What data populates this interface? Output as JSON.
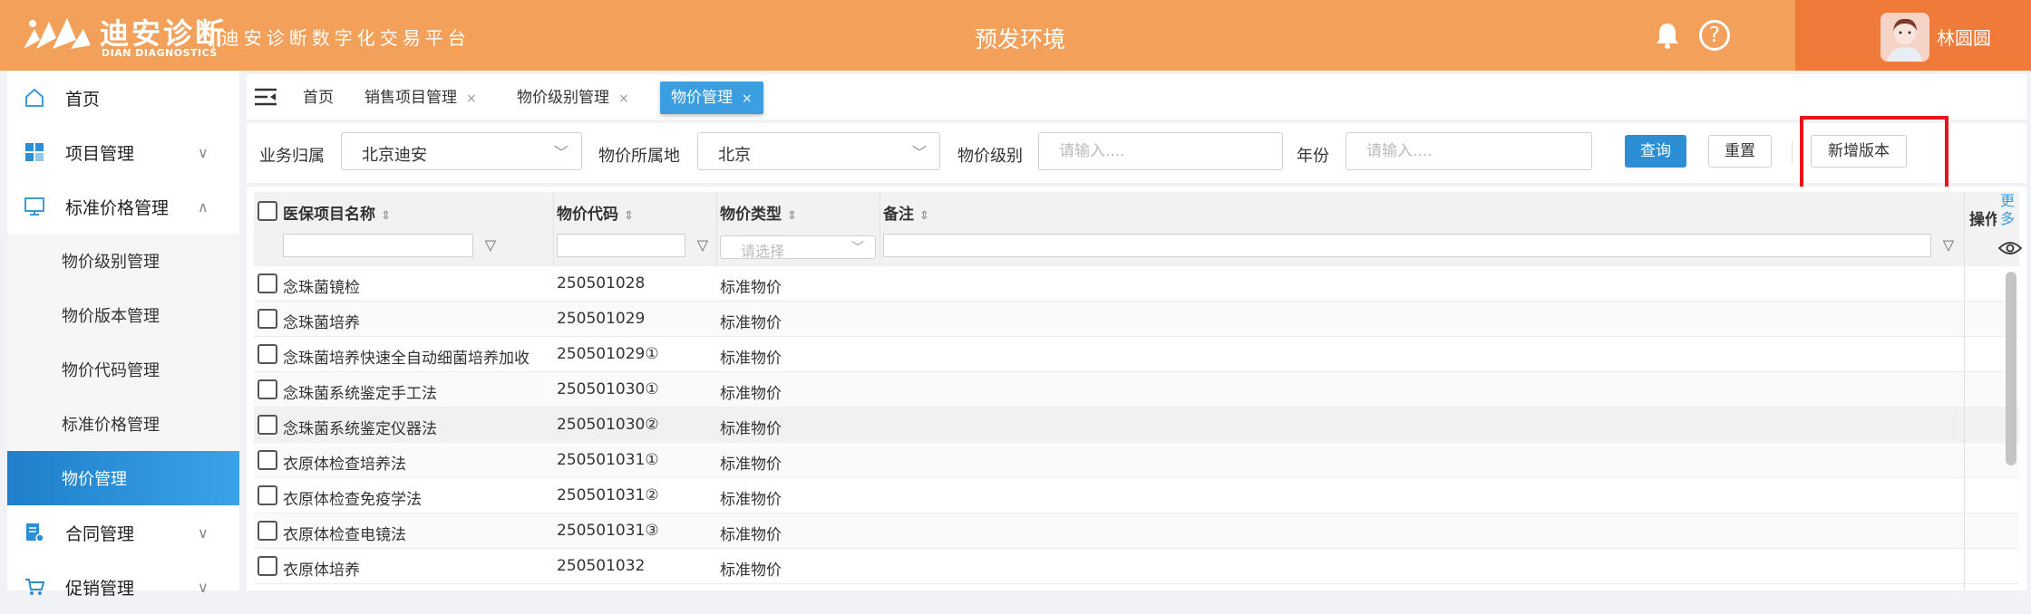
{
  "header": {
    "logo_text": "迪安诊断",
    "logo_subtext": "DIAN DIAGNOSTICS",
    "platform_title": "|迪安诊断数字化交易平台",
    "environment": "预发环境",
    "user_name": "林圆圆",
    "colors": {
      "bar": "#f2a05a",
      "accent": "#f07a3a"
    }
  },
  "sidebar": {
    "items": [
      {
        "label": "首页",
        "icon": "home-icon"
      },
      {
        "label": "项目管理",
        "icon": "grid-icon",
        "chevron": "∨"
      },
      {
        "label": "标准价格管理",
        "icon": "monitor-icon",
        "chevron": "∧"
      },
      {
        "label": "合同管理",
        "icon": "contract-icon",
        "chevron": "∨"
      },
      {
        "label": "促销管理",
        "icon": "cart-icon",
        "chevron": "∨"
      }
    ],
    "submenu": [
      {
        "label": "物价级别管理"
      },
      {
        "label": "物价版本管理"
      },
      {
        "label": "物价代码管理"
      },
      {
        "label": "标准价格管理"
      },
      {
        "label": "物价管理",
        "active": true
      }
    ],
    "active_color": "#2c8fd6"
  },
  "tabs": [
    {
      "label": "首页"
    },
    {
      "label": "销售项目管理",
      "close": "×"
    },
    {
      "label": "物价级别管理",
      "close": "×"
    },
    {
      "label": "物价管理",
      "close": "×",
      "active": true
    }
  ],
  "filters": {
    "business_label": "业务归属",
    "business_value": "北京迪安",
    "location_label": "物价所属地",
    "location_value": "北京",
    "level_label": "物价级别",
    "level_placeholder": "请输入....",
    "year_label": "年份",
    "year_placeholder": "请输入....",
    "query_button": "查询",
    "reset_button": "重置",
    "add_version_button": "新增版本"
  },
  "table": {
    "columns": [
      "医保项目名称",
      "物价代码",
      "物价类型",
      "备注",
      "操作"
    ],
    "sort_glyph": "⇕",
    "type_placeholder": "请选择",
    "more_label": "更多",
    "rows": [
      {
        "name": "念珠菌镜检",
        "code": "250501028",
        "type": "标准物价"
      },
      {
        "name": "念珠菌培养",
        "code": "250501029",
        "type": "标准物价"
      },
      {
        "name": "念珠菌培养快速全自动细菌培养加收",
        "code": "250501029①",
        "type": "标准物价"
      },
      {
        "name": "念珠菌系统鉴定手工法",
        "code": "250501030①",
        "type": "标准物价"
      },
      {
        "name": "念珠菌系统鉴定仪器法",
        "code": "250501030②",
        "type": "标准物价"
      },
      {
        "name": "衣原体检查培养法",
        "code": "250501031①",
        "type": "标准物价"
      },
      {
        "name": "衣原体检查免疫学法",
        "code": "250501031②",
        "type": "标准物价"
      },
      {
        "name": "衣原体检查电镜法",
        "code": "250501031③",
        "type": "标准物价"
      },
      {
        "name": "衣原体培养",
        "code": "250501032",
        "type": "标准物价"
      }
    ]
  }
}
